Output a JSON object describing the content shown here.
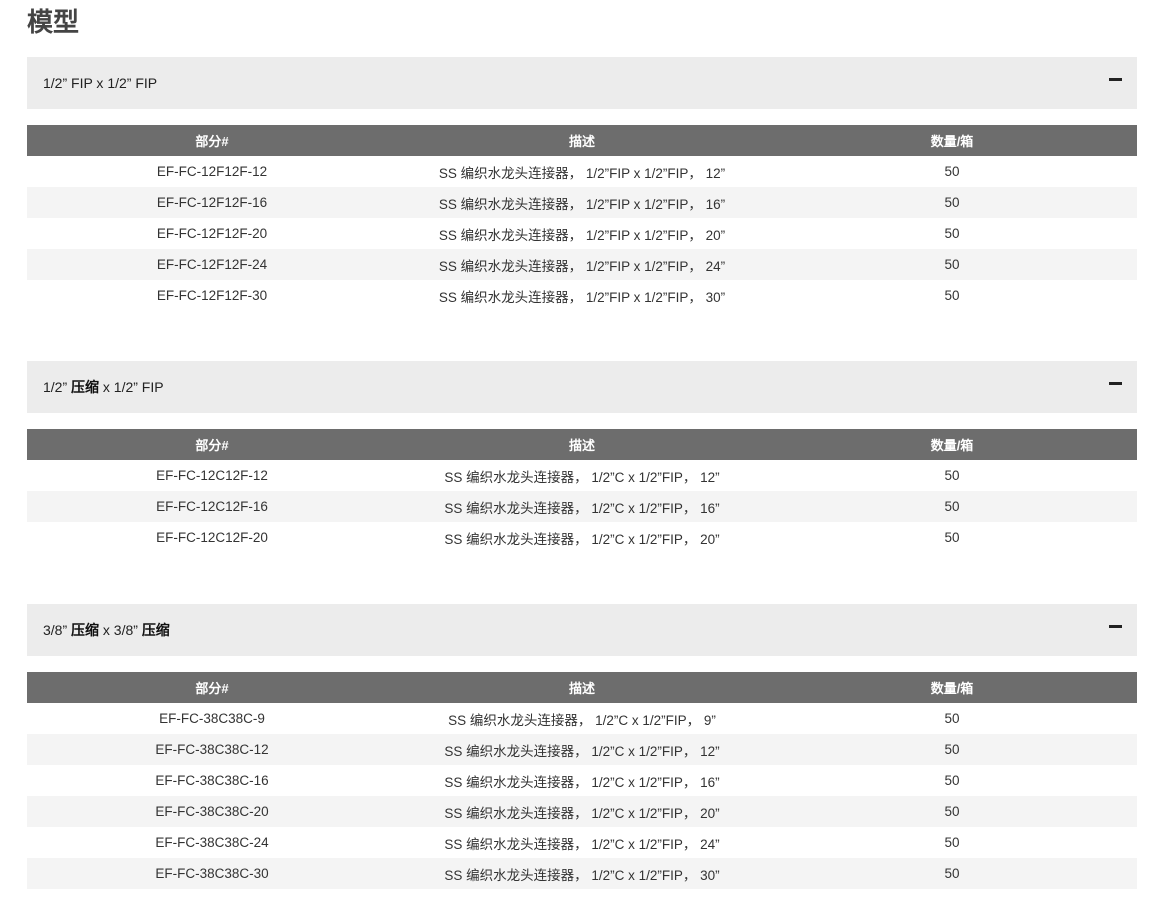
{
  "page_title": "模型",
  "columns": [
    "部分#",
    "描述",
    "数量/箱"
  ],
  "sections": [
    {
      "title": [
        "1/2” FIP x 1/2” FIP"
      ],
      "rows": [
        [
          "EF-FC-12F12F-12",
          "SS 编织水龙头连接器， 1/2”FIP x 1/2”FIP， 12”",
          "50"
        ],
        [
          "EF-FC-12F12F-16",
          "SS 编织水龙头连接器， 1/2”FIP x 1/2”FIP， 16”",
          "50"
        ],
        [
          "EF-FC-12F12F-20",
          "SS 编织水龙头连接器， 1/2”FIP x 1/2”FIP， 20”",
          "50"
        ],
        [
          "EF-FC-12F12F-24",
          "SS 编织水龙头连接器， 1/2”FIP x 1/2”FIP， 24”",
          "50"
        ],
        [
          "EF-FC-12F12F-30",
          "SS 编织水龙头连接器， 1/2”FIP x 1/2”FIP， 30”",
          "50"
        ]
      ]
    },
    {
      "title": [
        "1/2” ",
        "压缩",
        " x 1/2” FIP"
      ],
      "rows": [
        [
          "EF-FC-12C12F-12",
          "SS 编织水龙头连接器， 1/2”C x 1/2”FIP， 12”",
          "50"
        ],
        [
          "EF-FC-12C12F-16",
          "SS 编织水龙头连接器， 1/2”C x 1/2”FIP， 16”",
          "50"
        ],
        [
          "EF-FC-12C12F-20",
          "SS 编织水龙头连接器， 1/2”C x 1/2”FIP， 20”",
          "50"
        ]
      ]
    },
    {
      "title": [
        "3/8” ",
        "压缩",
        " x 3/8” ",
        "压缩"
      ],
      "rows": [
        [
          "EF-FC-38C38C-9",
          "SS 编织水龙头连接器， 1/2”C x 1/2”FIP， 9”",
          "50"
        ],
        [
          "EF-FC-38C38C-12",
          "SS 编织水龙头连接器， 1/2”C x 1/2”FIP， 12”",
          "50"
        ],
        [
          "EF-FC-38C38C-16",
          "SS 编织水龙头连接器， 1/2”C x 1/2”FIP， 16”",
          "50"
        ],
        [
          "EF-FC-38C38C-20",
          "SS 编织水龙头连接器， 1/2”C x 1/2”FIP， 20”",
          "50"
        ],
        [
          "EF-FC-38C38C-24",
          "SS 编织水龙头连接器， 1/2”C x 1/2”FIP， 24”",
          "50"
        ],
        [
          "EF-FC-38C38C-30",
          "SS 编织水龙头连接器， 1/2”C x 1/2”FIP， 30”",
          "50"
        ]
      ]
    }
  ]
}
